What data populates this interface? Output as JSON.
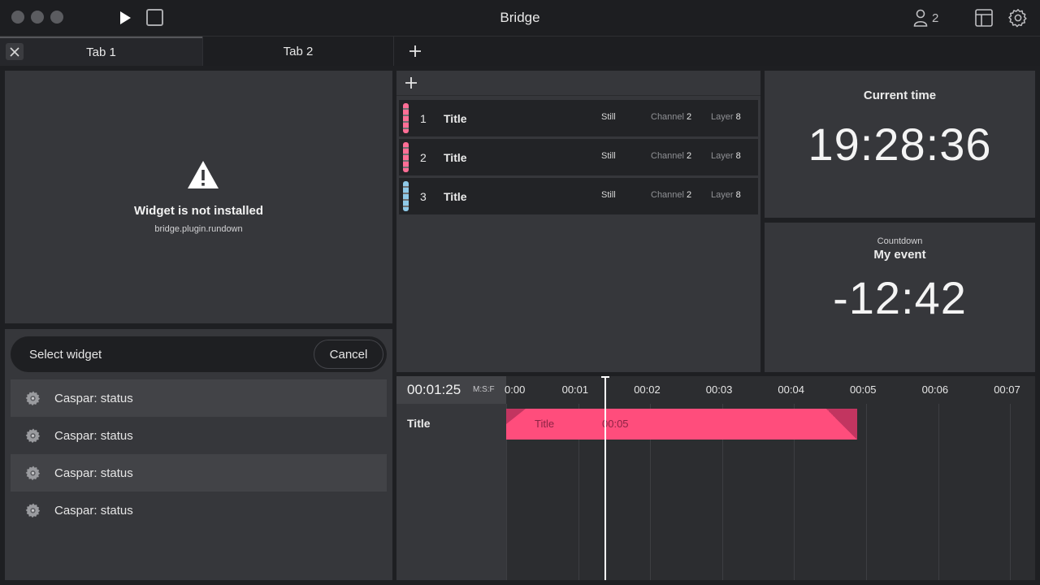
{
  "app": {
    "title": "Bridge",
    "user_count": "2"
  },
  "tabs": [
    {
      "label": "Tab 1",
      "active": true
    },
    {
      "label": "Tab 2",
      "active": false
    }
  ],
  "warning_widget": {
    "title": "Widget is not installed",
    "plugin_id": "bridge.plugin.rundown"
  },
  "widget_selector": {
    "label": "Select widget",
    "cancel_label": "Cancel",
    "items": [
      {
        "label": "Caspar: status",
        "highlighted": true
      },
      {
        "label": "Caspar: status",
        "highlighted": false
      },
      {
        "label": "Caspar: status",
        "highlighted": true
      },
      {
        "label": "Caspar: status",
        "highlighted": false
      }
    ]
  },
  "rundown": {
    "rows": [
      {
        "num": "1",
        "title": "Title",
        "type": "Still",
        "channel_label": "Channel",
        "channel": "2",
        "layer_label": "Layer",
        "layer": "8",
        "color": "#ff6e96"
      },
      {
        "num": "2",
        "title": "Title",
        "type": "Still",
        "channel_label": "Channel",
        "channel": "2",
        "layer_label": "Layer",
        "layer": "8",
        "color": "#ff6e96"
      },
      {
        "num": "3",
        "title": "Title",
        "type": "Still",
        "channel_label": "Channel",
        "channel": "2",
        "layer_label": "Layer",
        "layer": "8",
        "color": "#8ec9e8"
      }
    ]
  },
  "clock": {
    "label": "Current time",
    "value": "19:28:36"
  },
  "countdown": {
    "label": "Countdown",
    "event": "My event",
    "value": "-12:42"
  },
  "timeline": {
    "current_time": "00:01:25",
    "format": "M:S:F",
    "ticks": [
      "0:00",
      "00:01",
      "00:02",
      "00:03",
      "00:04",
      "00:05",
      "00:06",
      "00:07"
    ],
    "track_label": "Title",
    "clip": {
      "title": "Title",
      "duration": "00:05"
    },
    "colors": {
      "clip": "#ff4d7c",
      "clip_edge": "#c23560"
    }
  }
}
